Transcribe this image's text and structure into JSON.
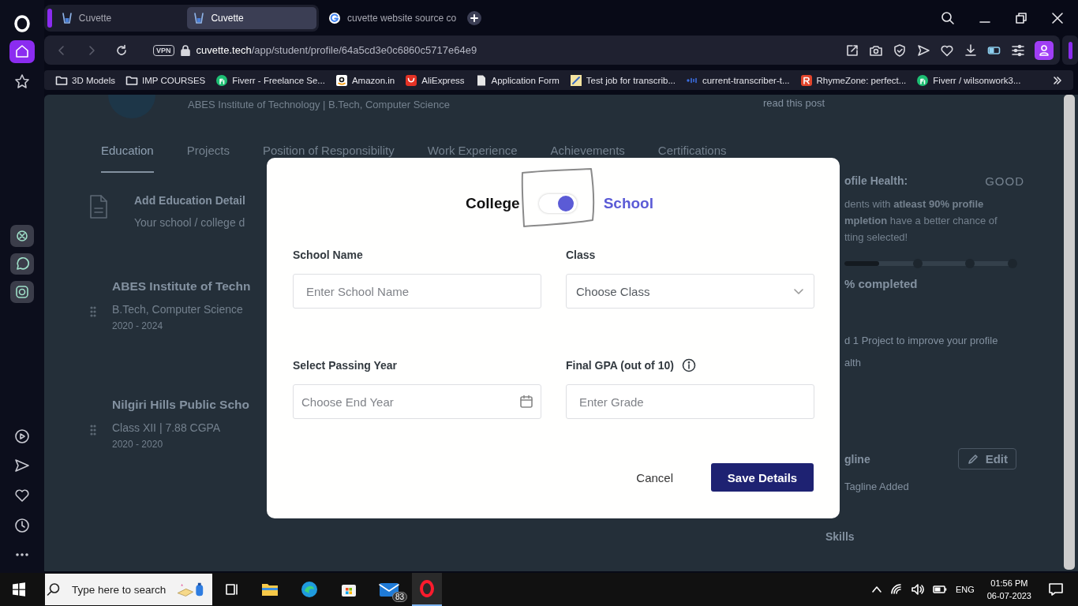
{
  "browser": {
    "tabs": [
      {
        "title": "Cuvette",
        "selected": false,
        "kind": "cuvette"
      },
      {
        "title": "Cuvette",
        "selected": true,
        "kind": "cuvette"
      },
      {
        "title": "cuvette website source co",
        "selected": false,
        "kind": "google"
      }
    ],
    "address": {
      "vpn": "VPN",
      "host": "cuvette.tech",
      "path": "/app/student/profile/64a5cd3e0c6860c5717e64e9"
    },
    "bookmarks": [
      {
        "label": "3D Models",
        "kind": "folder"
      },
      {
        "label": "IMP COURSES",
        "kind": "folder"
      },
      {
        "label": "Fiverr - Freelance Se...",
        "kind": "fiverr"
      },
      {
        "label": "Amazon.in",
        "kind": "amazon"
      },
      {
        "label": "AliExpress",
        "kind": "aliexpress"
      },
      {
        "label": "Application Form",
        "kind": "doc"
      },
      {
        "label": "Test job for transcrib...",
        "kind": "test"
      },
      {
        "label": "current-transcriber-t...",
        "kind": "otter"
      },
      {
        "label": "RhymeZone: perfect...",
        "kind": "rhyme"
      },
      {
        "label": "Fiverr / wilsonwork3...",
        "kind": "fiverr"
      }
    ]
  },
  "page": {
    "subtitle": "ABES Institute of Technology | B.Tech, Computer Science",
    "read_post": "read this post",
    "tabs": [
      {
        "label": "Education",
        "selected": true
      },
      {
        "label": "Projects",
        "selected": false
      },
      {
        "label": "Position of Responsibility",
        "selected": false
      },
      {
        "label": "Work Experience",
        "selected": false
      },
      {
        "label": "Achievements",
        "selected": false
      },
      {
        "label": "Certifications",
        "selected": false
      }
    ],
    "add_education": {
      "title": "Add Education Detail",
      "subtitle": "Your school / college d"
    },
    "education": [
      {
        "institution": "ABES Institute of Techn",
        "degree": "B.Tech, Computer Science",
        "years": "2020 - 2024"
      },
      {
        "institution": "Nilgiri Hills Public Scho",
        "degree": "Class XII | 7.88 CGPA",
        "years": "2020 - 2020"
      }
    ],
    "health": {
      "label": "ofile Health:",
      "rating": "GOOD",
      "lines": [
        "dents with **atleast 90% profile**",
        "**mpletion** have a better chance of",
        "tting selected!"
      ],
      "level": 0.2,
      "caption": "% completed",
      "suggestion": [
        "d 1 Project to improve your profile",
        "alth"
      ]
    },
    "tagline": {
      "title": "gline",
      "edit": "Edit",
      "empty": "Tagline Added"
    },
    "skills": "Skills"
  },
  "modal": {
    "toggle": {
      "left": "College",
      "right": "School",
      "on": true
    },
    "fields": [
      {
        "label": "School Name",
        "placeholder": "Enter School Name",
        "kind": "text",
        "info": false
      },
      {
        "label": "Class",
        "placeholder": "Choose Class",
        "kind": "select",
        "info": false
      },
      {
        "label": "Select Passing Year",
        "placeholder": "Choose End Year",
        "kind": "date",
        "info": false
      },
      {
        "label": "Final GPA (out of 10)",
        "placeholder": "Enter Grade",
        "kind": "text",
        "info": true
      }
    ],
    "cancel": "Cancel",
    "save": "Save Details"
  },
  "taskbar": {
    "search_placeholder": "Type here to search",
    "mail_badge": "83",
    "language": "ENG",
    "time": "01:56 PM",
    "date": "06-07-2023"
  }
}
